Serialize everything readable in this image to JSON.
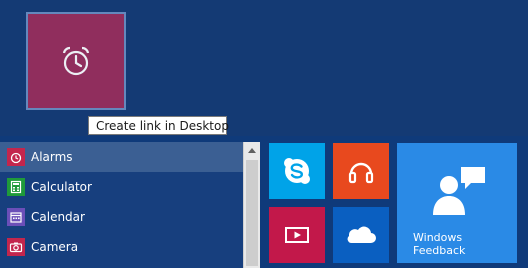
{
  "tooltip": {
    "text": "Create link in Desktop"
  },
  "app_list": {
    "items": [
      {
        "label": "Alarms",
        "icon": "alarm-clock-icon",
        "selected": true
      },
      {
        "label": "Calculator",
        "icon": "calculator-icon",
        "selected": false
      },
      {
        "label": "Calendar",
        "icon": "calendar-icon",
        "selected": false
      },
      {
        "label": "Camera",
        "icon": "camera-icon",
        "selected": false
      }
    ]
  },
  "tiles": {
    "skype": {
      "icon": "skype-icon",
      "color": "#00a3e8"
    },
    "music": {
      "icon": "headphones-icon",
      "color": "#e8491e"
    },
    "video": {
      "icon": "video-play-icon",
      "color": "#c2184a"
    },
    "onedrive": {
      "icon": "cloud-icon",
      "color": "#0a5fc1"
    },
    "feedback": {
      "label_line1": "Windows",
      "label_line2": "Feedback",
      "icon": "feedback-person-icon",
      "color": "#2a8ae6"
    }
  },
  "drag_tile": {
    "icon": "alarm-clock-icon",
    "color": "#9b2d5c"
  }
}
